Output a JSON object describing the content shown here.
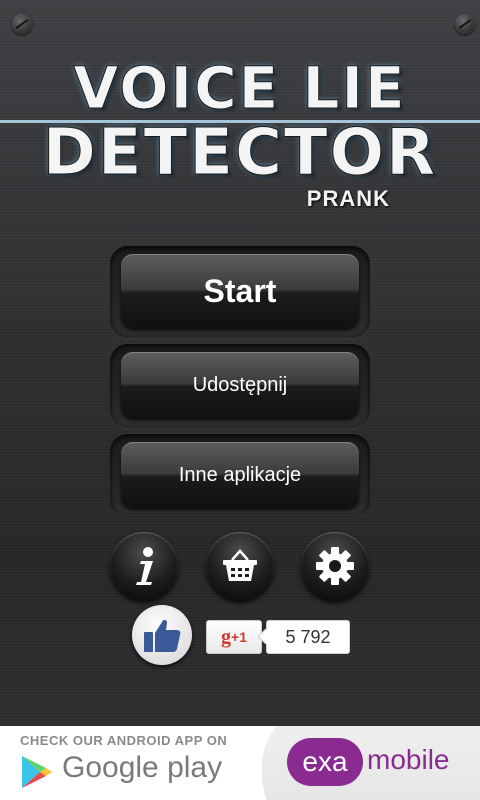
{
  "header": {
    "title_line1": "VOICE LIE",
    "title_line2": "DETECTOR",
    "subtitle": "PRANK"
  },
  "menu": {
    "start_label": "Start",
    "share_label": "Udostępnij",
    "other_apps_label": "Inne aplikacje"
  },
  "icons": {
    "info": "info-icon",
    "shop": "basket-icon",
    "settings": "gear-icon"
  },
  "social": {
    "like_icon": "thumbs-up-icon",
    "gplus_g": "g",
    "gplus_plus": "+1",
    "gplus_count": "5 792"
  },
  "ad": {
    "caption": "CHECK OUR ANDROID APP ON",
    "store_name": "Google play",
    "brand_exa": "exa",
    "brand_mobile": "mobile"
  },
  "colors": {
    "brand_purple": "#8a2b92",
    "gplus_red": "#d0392b",
    "wave_blue": "#3fb8ff"
  }
}
